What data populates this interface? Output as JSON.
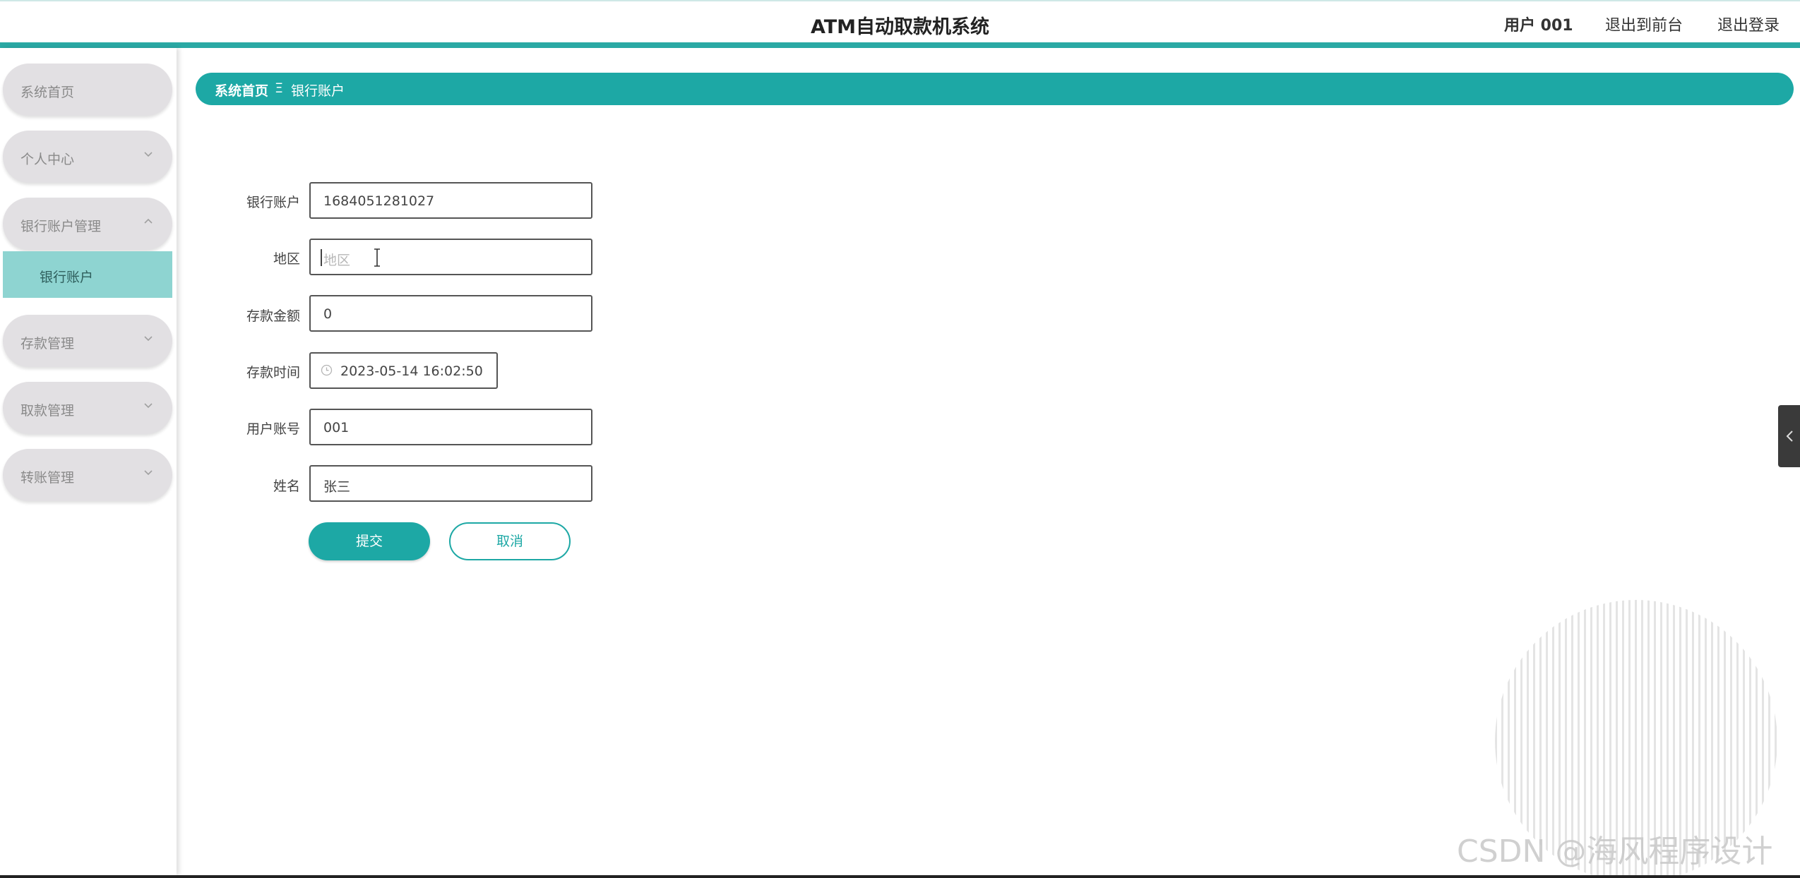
{
  "header": {
    "title": "ATM自动取款机系统",
    "user": "用户 001",
    "front_link": "退出到前台",
    "logout": "退出登录"
  },
  "sidebar": {
    "items": [
      {
        "label": "系统首页",
        "chevron": "none"
      },
      {
        "label": "个人中心",
        "chevron": "down"
      },
      {
        "label": "银行账户管理",
        "chevron": "up"
      },
      {
        "label": "存款管理",
        "chevron": "down"
      },
      {
        "label": "取款管理",
        "chevron": "down"
      },
      {
        "label": "转账管理",
        "chevron": "down"
      }
    ],
    "active_sub": "银行账户"
  },
  "breadcrumb": {
    "home": "系统首页",
    "separator": "Ξ",
    "current": "银行账户"
  },
  "form": {
    "account_label": "银行账户",
    "account_value": "1684051281027",
    "region_label": "地区",
    "region_placeholder": "地区",
    "amount_label": "存款金额",
    "amount_value": "0",
    "time_label": "存款时间",
    "time_value": "2023-05-14 16:02:50",
    "user_label": "用户账号",
    "user_value": "001",
    "name_label": "姓名",
    "name_value": "张三"
  },
  "buttons": {
    "submit": "提交",
    "cancel": "取消"
  },
  "watermark": "CSDN @海风程序设计",
  "colors": {
    "accent": "#1da8a5",
    "active_sub_bg": "#8ed4d1",
    "menu_bg": "#e2e0e3"
  }
}
